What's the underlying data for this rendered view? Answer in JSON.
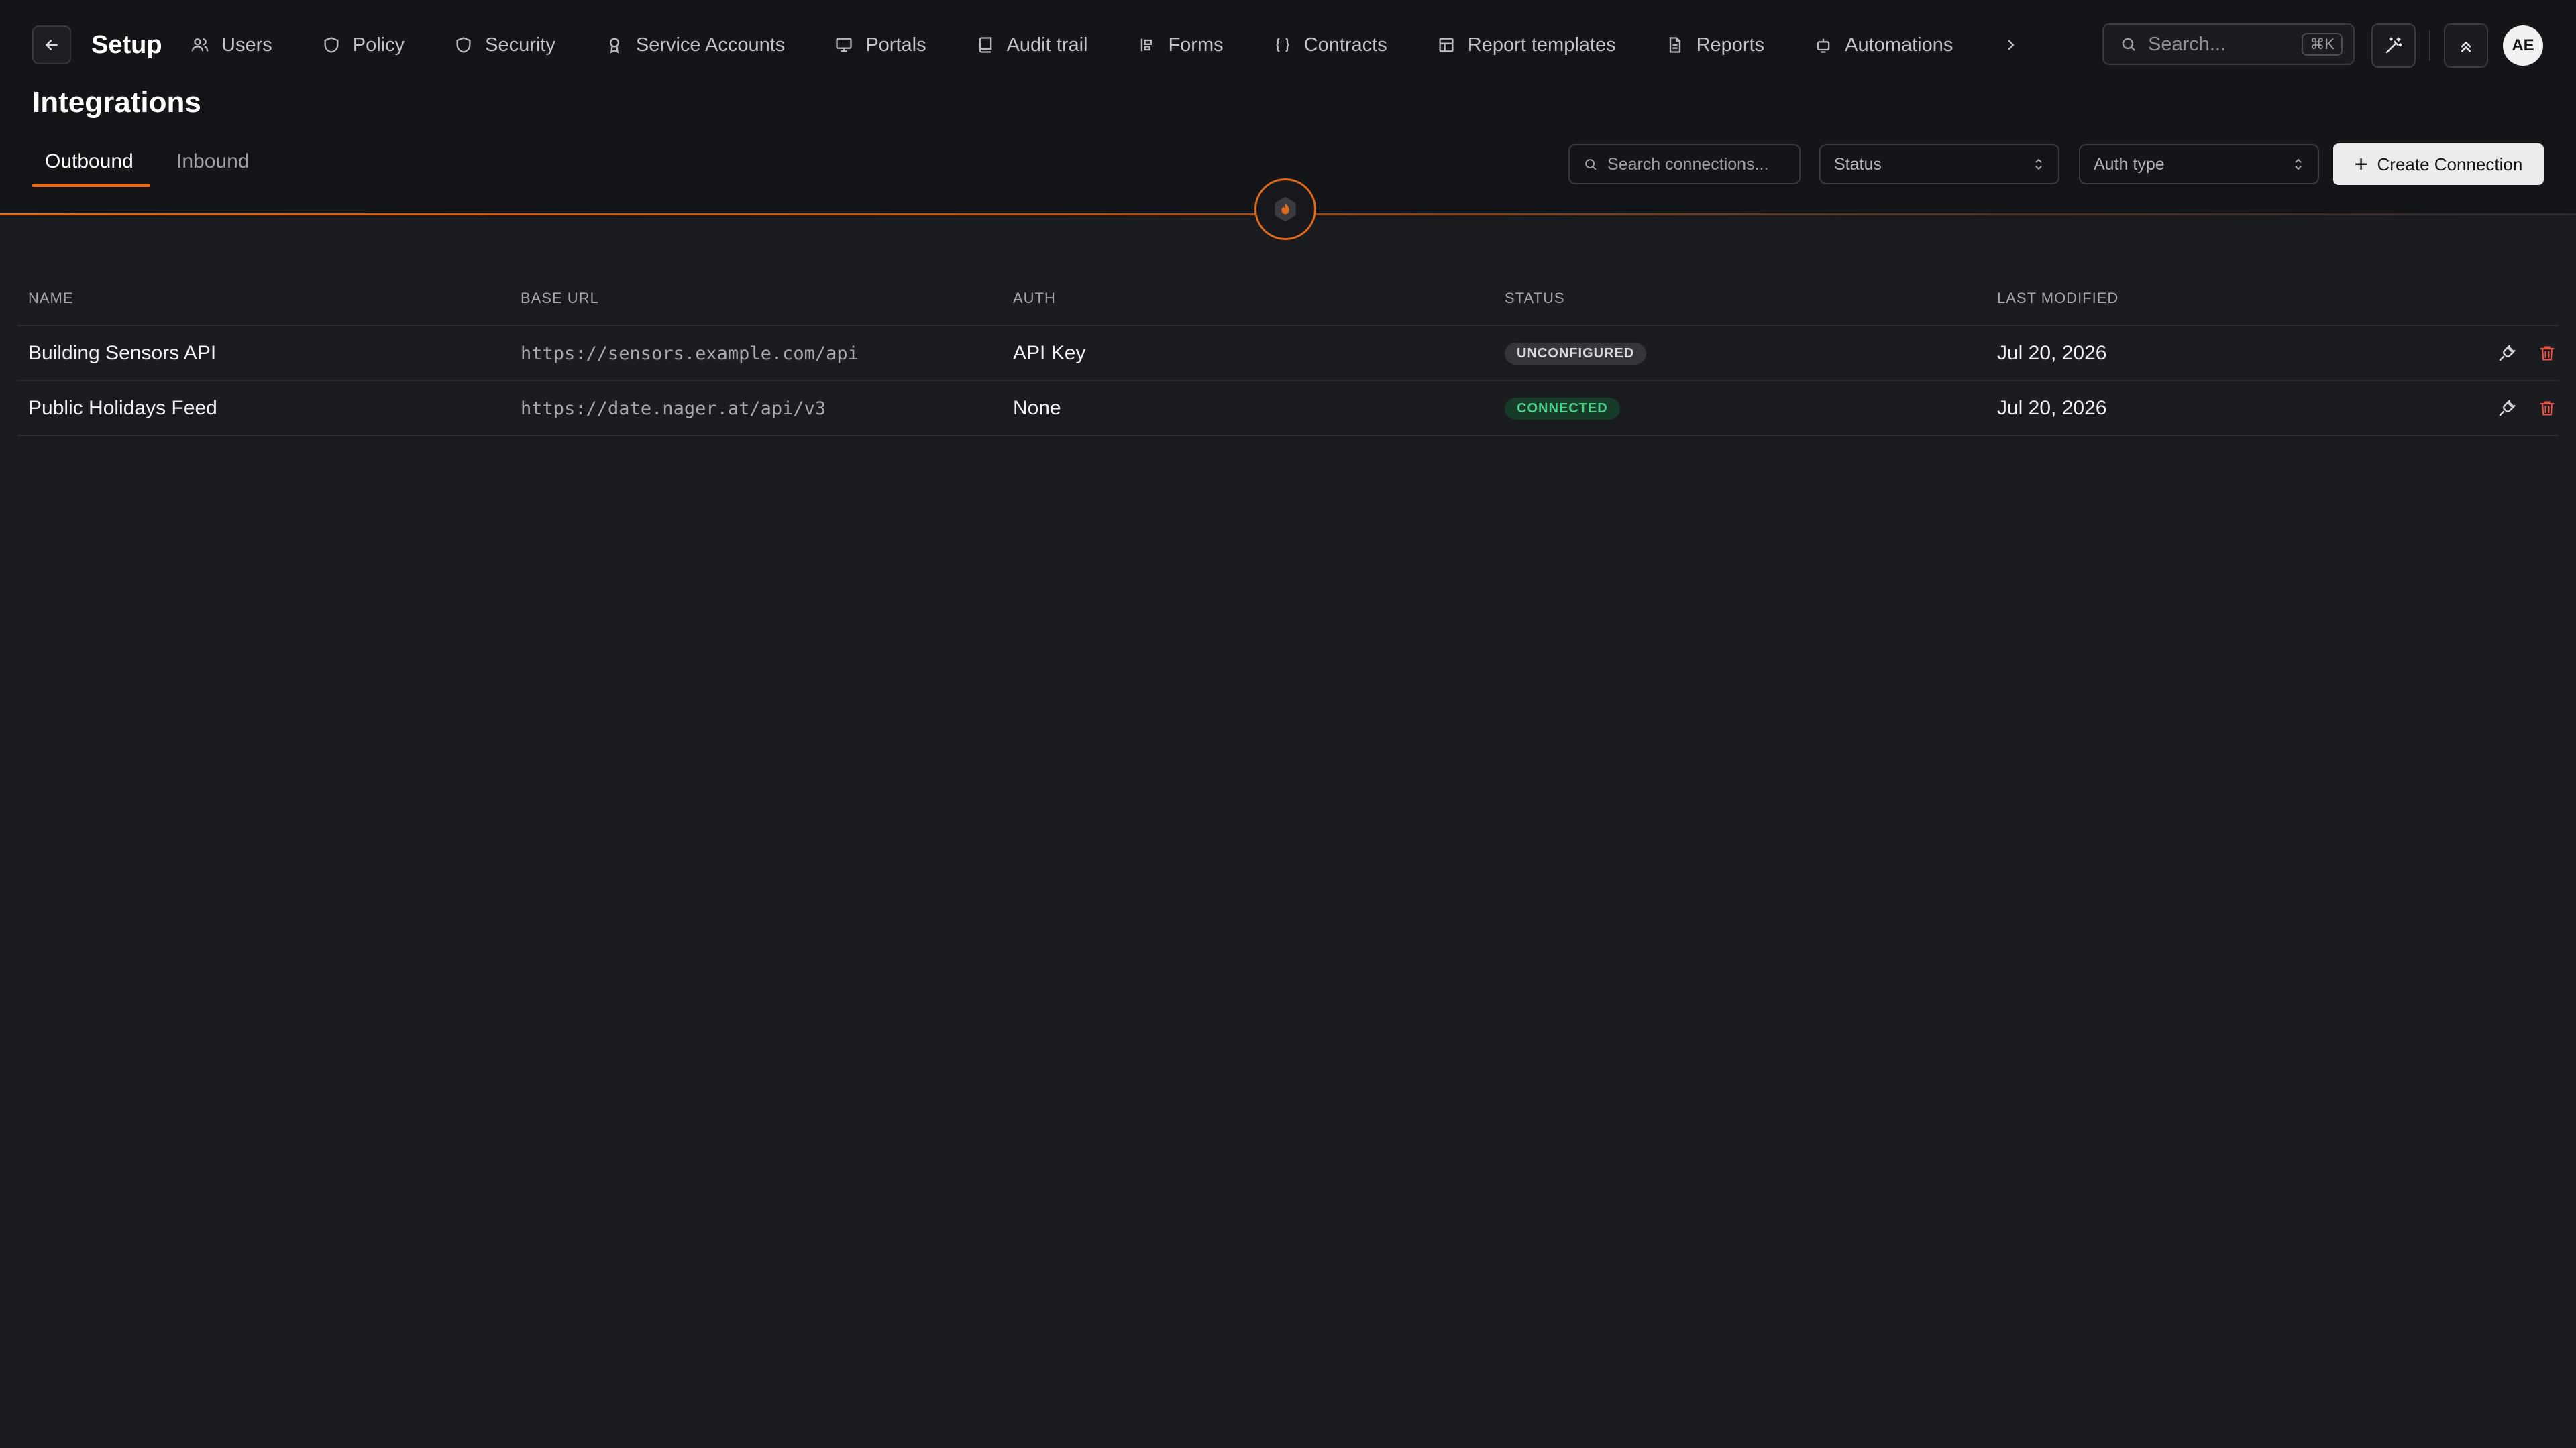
{
  "app": {
    "title": "Setup"
  },
  "nav": {
    "items": [
      {
        "label": "Users",
        "icon": "users-icon"
      },
      {
        "label": "Policy",
        "icon": "shield-icon"
      },
      {
        "label": "Security",
        "icon": "shield-icon"
      },
      {
        "label": "Service Accounts",
        "icon": "badge-icon"
      },
      {
        "label": "Portals",
        "icon": "monitor-icon"
      },
      {
        "label": "Audit trail",
        "icon": "book-icon"
      },
      {
        "label": "Forms",
        "icon": "forms-icon"
      },
      {
        "label": "Contracts",
        "icon": "braces-icon"
      },
      {
        "label": "Report templates",
        "icon": "template-icon"
      },
      {
        "label": "Reports",
        "icon": "file-icon"
      },
      {
        "label": "Automations",
        "icon": "robot-icon"
      }
    ]
  },
  "search": {
    "placeholder": "Search...",
    "shortcut": "⌘K"
  },
  "user": {
    "initials": "AE"
  },
  "page": {
    "title": "Integrations"
  },
  "tabs": {
    "outbound": "Outbound",
    "inbound": "Inbound"
  },
  "filters": {
    "search_placeholder": "Search connections...",
    "status_label": "Status",
    "auth_label": "Auth type"
  },
  "actions": {
    "create": "Create Connection"
  },
  "table": {
    "headers": {
      "name": "NAME",
      "url": "BASE URL",
      "auth": "AUTH",
      "status": "STATUS",
      "modified": "LAST MODIFIED"
    },
    "rows": [
      {
        "name": "Building Sensors API",
        "url": "https://sensors.example.com/api",
        "auth": "API Key",
        "status": "UNCONFIGURED",
        "modified": "Jul 20, 2026"
      },
      {
        "name": "Public Holidays Feed",
        "url": "https://date.nager.at/api/v3",
        "auth": "None",
        "status": "CONNECTED",
        "modified": "Jul 20, 2026"
      }
    ]
  },
  "colors": {
    "accent": "#e06a1a",
    "connected": "#4fd18a",
    "danger": "#e0544a",
    "background": "#1b1c20"
  }
}
